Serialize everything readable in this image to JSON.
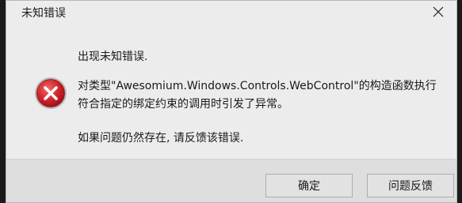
{
  "window": {
    "title": "未知错误",
    "close_icon": "close-icon"
  },
  "message": {
    "header": "出现未知错误.",
    "detail": "对类型\"Awesomium.Windows.Controls.WebControl\"的构造函数执行符合指定的绑定约束的调用时引发了异常。",
    "footer": "如果问题仍然存在, 请反馈该错误.",
    "icon": "error-icon"
  },
  "buttons": {
    "ok_label": "确定",
    "feedback_label": "问题反馈"
  },
  "colors": {
    "dialog_bg": "#ececec",
    "button_bar_bg": "#dedede",
    "error_red": "#c9252c"
  }
}
